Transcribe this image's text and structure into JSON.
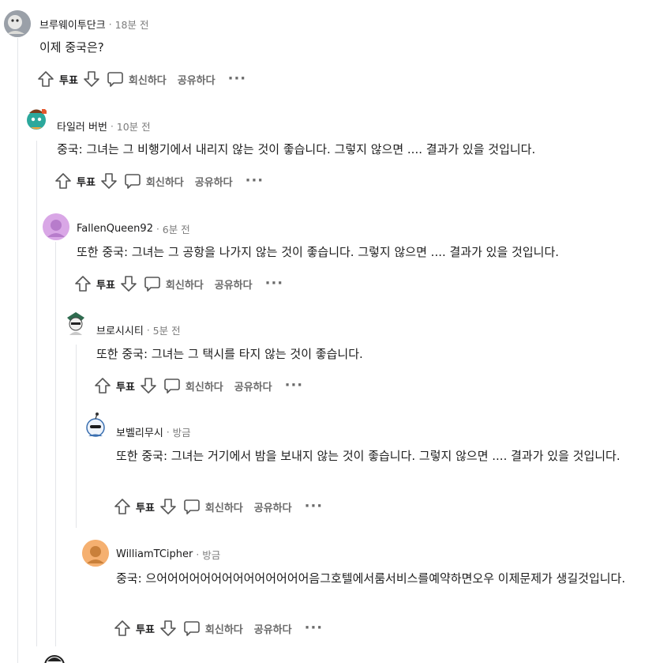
{
  "actions": {
    "vote_label": "투표",
    "reply_label": "회신하다",
    "share_label": "공유하다",
    "more_label": "···"
  },
  "comments": [
    {
      "username": "브루웨이투단크",
      "sep": "·",
      "time": "18분 전",
      "body": "이제 중국은?"
    },
    {
      "username": "타일러 버번",
      "sep": "·",
      "time": "10분 전",
      "body": "중국: 그녀는 그 비행기에서 내리지 않는 것이 좋습니다. 그렇지 않으면 .... 결과가 있을 것입니다."
    },
    {
      "username": "FallenQueen92",
      "sep": "·",
      "time": "6분 전",
      "body": "또한 중국: 그녀는 그 공항을 나가지 않는 것이 좋습니다. 그렇지 않으면 .... 결과가 있을 것입니다."
    },
    {
      "username": "브로시시티",
      "sep": "·",
      "time": "5분 전",
      "body": "또한 중국: 그녀는 그 택시를 타지 않는 것이 좋습니다."
    },
    {
      "username": "보벨리무시",
      "sep": "·",
      "time": "방금",
      "body": "또한 중국: 그녀는 거기에서 밤을 보내지 않는 것이 좋습니다. 그렇지 않으면 .... 결과가 있을 것입니다."
    },
    {
      "username": "WilliamTCipher",
      "sep": "·",
      "time": "방금",
      "body": "중국: 으어어어어어어어어어어어어어어음그호텔에서룸서비스를예약하면오우 이제문제가 생길것입니다."
    }
  ]
}
